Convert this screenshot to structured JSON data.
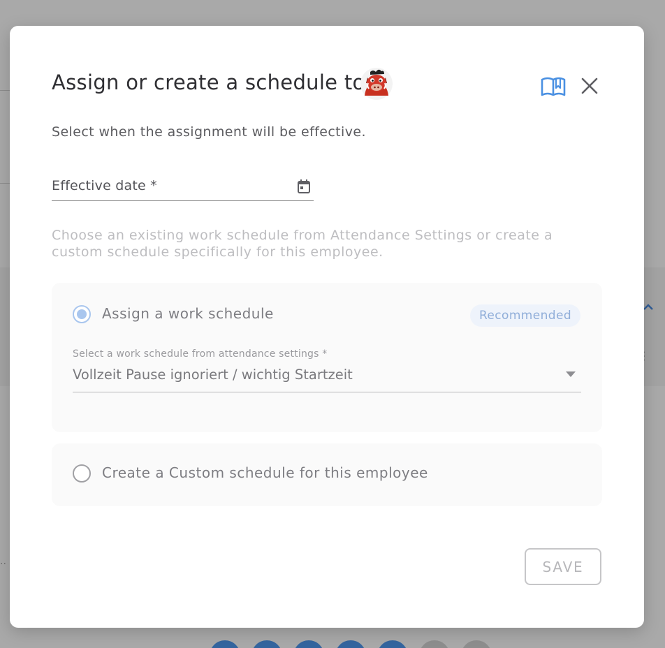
{
  "dialog": {
    "title": "Assign or create a schedule to",
    "subtitle": "Select when the assignment will be effective.",
    "avatar_icon": "boar-avatar-icon",
    "guide_icon": "book-open-icon",
    "close_icon": "close-icon"
  },
  "effective_date": {
    "label": "Effective date *",
    "value": "",
    "icon": "calendar-icon"
  },
  "helper_text": "Choose an existing work schedule from Attendance Settings or create a custom schedule specifically for this employee.",
  "options": {
    "assign": {
      "label": "Assign a work schedule",
      "selected": true,
      "badge": "Recommended",
      "select": {
        "label": "Select a work schedule from attendance settings *",
        "value": "Vollzeit Pause ignoriert / wichtig Startzeit"
      }
    },
    "custom": {
      "label": "Create a Custom schedule for this employee",
      "selected": false
    }
  },
  "actions": {
    "save_label": "SAVE"
  },
  "colors": {
    "accent_blue": "#4a90e2",
    "radio_selected": "#a9c6ee",
    "badge_bg": "#eef3fb",
    "badge_text": "#90aed9"
  }
}
